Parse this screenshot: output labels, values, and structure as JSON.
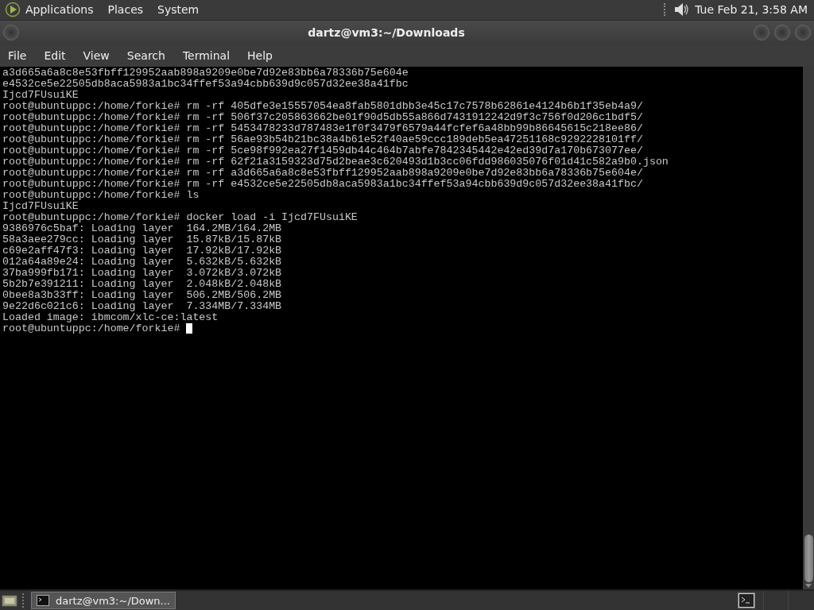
{
  "top_panel": {
    "menus": [
      "Applications",
      "Places",
      "System"
    ],
    "clock": "Tue Feb 21,  3:58 AM"
  },
  "window": {
    "title": "dartz@vm3:~/Downloads"
  },
  "menu_bar": [
    "File",
    "Edit",
    "View",
    "Search",
    "Terminal",
    "Help"
  ],
  "terminal": {
    "lines": [
      "a3d665a6a8c8e53fbff129952aab898a9209e0be7d92e83bb6a78336b75e604e",
      "e4532ce5e22505db8aca5983a1bc34ffef53a94cbb639d9c057d32ee38a41fbc",
      "Ijcd7FUsuiKE",
      "root@ubuntuppc:/home/forkie# rm -rf 405dfe3e15557054ea8fab5801dbb3e45c17c7578b62861e4124b6b1f35eb4a9/",
      "root@ubuntuppc:/home/forkie# rm -rf 506f37c205863662be01f90d5db55a866d7431912242d9f3c756f0d206c1bdf5/",
      "root@ubuntuppc:/home/forkie# rm -rf 5453478233d787483e1f0f3479f6579a44fcfef6a48bb99b86645615c218ee86/",
      "root@ubuntuppc:/home/forkie# rm -rf 56ae93b54b21bc38a4b61e52f40ae59ccc189deb5ea47251168c9292228101ff/",
      "root@ubuntuppc:/home/forkie# rm -rf 5ce98f992ea27f1459db44c464b7abfe7842345442e42ed39d7a170b673077ee/",
      "root@ubuntuppc:/home/forkie# rm -rf 62f21a3159323d75d2beae3c620493d1b3cc06fdd986035076f01d41c582a9b0.json",
      "root@ubuntuppc:/home/forkie# rm -rf a3d665a6a8c8e53fbff129952aab898a9209e0be7d92e83bb6a78336b75e604e/",
      "root@ubuntuppc:/home/forkie# rm -rf e4532ce5e22505db8aca5983a1bc34ffef53a94cbb639d9c057d32ee38a41fbc/",
      "root@ubuntuppc:/home/forkie# ls",
      "Ijcd7FUsuiKE",
      "root@ubuntuppc:/home/forkie# docker load -i Ijcd7FUsuiKE",
      "9386976c5baf: Loading layer  164.2MB/164.2MB",
      "58a3aee279cc: Loading layer  15.87kB/15.87kB",
      "c69e2aff47f3: Loading layer  17.92kB/17.92kB",
      "012a64a89e24: Loading layer  5.632kB/5.632kB",
      "37ba999fb171: Loading layer  3.072kB/3.072kB",
      "5b2b7e391211: Loading layer  2.048kB/2.048kB",
      "0bee8a3b33ff: Loading layer  506.2MB/506.2MB",
      "9e22d6c021c6: Loading layer  7.334MB/7.334MB",
      "Loaded image: ibmcom/xlc-ce:latest",
      "root@ubuntuppc:/home/forkie# "
    ]
  },
  "taskbar": {
    "tasks": [
      {
        "label": "dartz@vm3:~/Down...",
        "selected": true
      }
    ]
  }
}
